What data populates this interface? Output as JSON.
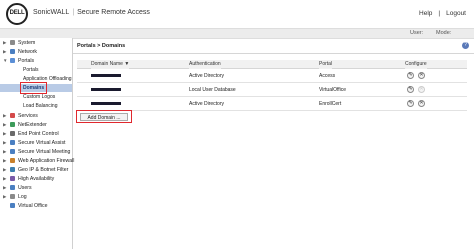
{
  "header": {
    "logo": "DELL",
    "product": "SonicWALL",
    "section": "Secure Remote Access",
    "help": "Help",
    "logout": "Logout"
  },
  "userbar": {
    "user_label": "User:",
    "mode_label": "Mode:"
  },
  "sidebar": {
    "items": [
      {
        "label": "System",
        "icon": "system-icon",
        "color": "#8a8a8a"
      },
      {
        "label": "Network",
        "icon": "network-icon",
        "color": "#4a7fc1"
      },
      {
        "label": "Portals",
        "icon": "portals-icon",
        "color": "#5b8fd6"
      },
      {
        "label": "Services",
        "icon": "services-icon",
        "color": "#d44a4a"
      },
      {
        "label": "NetExtender",
        "icon": "netextender-icon",
        "color": "#3c9b5a"
      },
      {
        "label": "End Point Control",
        "icon": "endpoint-icon",
        "color": "#6a6a6a"
      },
      {
        "label": "Secure Virtual Assist",
        "icon": "virtual-assist-icon",
        "color": "#4a7fc1"
      },
      {
        "label": "Secure Virtual Meeting",
        "icon": "virtual-meeting-icon",
        "color": "#4a7fc1"
      },
      {
        "label": "Web Application Firewall",
        "icon": "firewall-icon",
        "color": "#c9812b"
      },
      {
        "label": "Geo IP & Botnet Filter",
        "icon": "geoip-icon",
        "color": "#3c7fb0"
      },
      {
        "label": "High Availability",
        "icon": "high-availability-icon",
        "color": "#7a5aa8"
      },
      {
        "label": "Users",
        "icon": "users-icon",
        "color": "#4a7fc1"
      },
      {
        "label": "Log",
        "icon": "log-icon",
        "color": "#8a8a8a"
      },
      {
        "label": "Virtual Office",
        "icon": "virtual-office-icon",
        "color": "#4a7fc1"
      }
    ],
    "portal_subitems": [
      {
        "label": "Portals"
      },
      {
        "label": "Application Offloading"
      },
      {
        "label": "Domains"
      },
      {
        "label": "Custom Logos"
      },
      {
        "label": "Load Balancing"
      }
    ]
  },
  "content": {
    "breadcrumb": "Portals > Domains",
    "table": {
      "headers": [
        "Domain Name ▼",
        "Authentication",
        "Portal",
        "Configure"
      ],
      "rows": [
        {
          "authentication": "Active Directory",
          "portal": "Access"
        },
        {
          "authentication": "Local User Database",
          "portal": "VirtualOffice"
        },
        {
          "authentication": "Active Directory",
          "portal": "EnrollCert"
        }
      ]
    },
    "add_button": "Add Domain ..."
  },
  "colors": {
    "accent": "#b9cbe6",
    "highlight": "#e0282e"
  }
}
